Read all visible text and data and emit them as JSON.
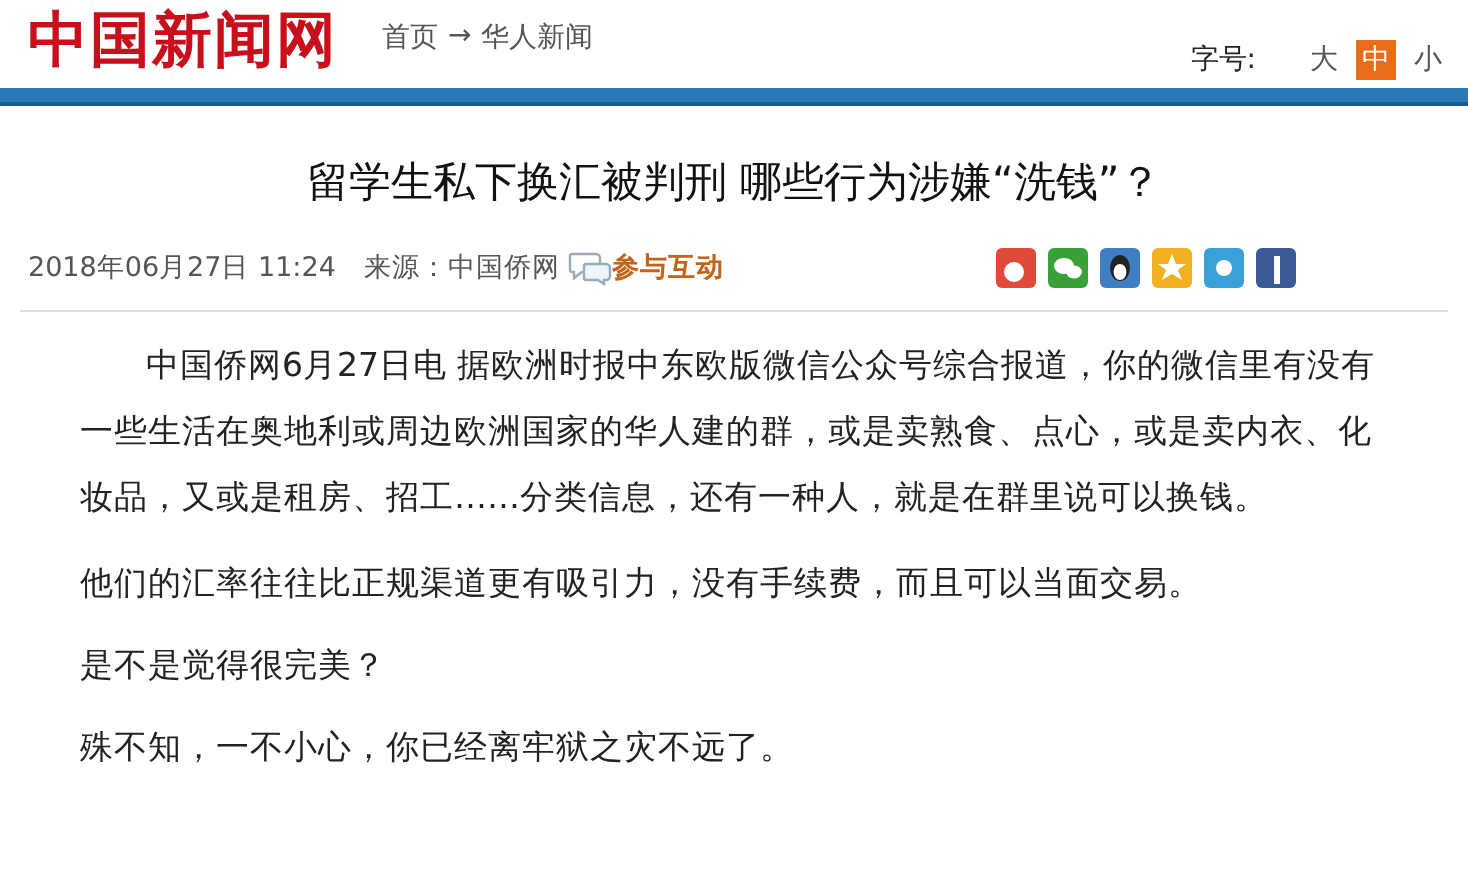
{
  "header": {
    "logo": "中国新闻网",
    "breadcrumb": [
      "首页",
      "华人新闻"
    ],
    "breadcrumb_separator": "→",
    "font_size_label": "字号:",
    "font_sizes": [
      {
        "label": "大",
        "selected": false
      },
      {
        "label": "中",
        "selected": true
      },
      {
        "label": "小",
        "selected": false
      }
    ]
  },
  "article": {
    "title": "留学生私下换汇被判刑 哪些行为涉嫌“洗钱”？",
    "date": "2018年06月27日 11:24",
    "source": "来源：中国侨网",
    "comment_link": "参与互动",
    "share_icons": [
      {
        "kind": "weibo",
        "color": "#e04a3a"
      },
      {
        "kind": "wechat",
        "color": "#3aa13a"
      },
      {
        "kind": "qq",
        "color": "#3d7fc2"
      },
      {
        "kind": "qzone",
        "color": "#f0b020"
      },
      {
        "kind": "tweibo",
        "color": "#3aa0d8"
      },
      {
        "kind": "facebook",
        "color": "#3b5998"
      }
    ],
    "paragraphs": [
      "中国侨网6月27日电 据欧洲时报中东欧版微信公众号综合报道，你的微信里有没有一些生活在奥地利或周边欧洲国家的华人建的群，或是卖熟食、点心，或是卖内衣、化妆品，又或是租房、招工……分类信息，还有一种人，就是在群里说可以换钱。",
      "他们的汇率往往比正规渠道更有吸引力，没有手续费，而且可以当面交易。",
      "是不是觉得很完美？",
      "殊不知，一不小心，你已经离牢狱之灾不远了。"
    ]
  }
}
